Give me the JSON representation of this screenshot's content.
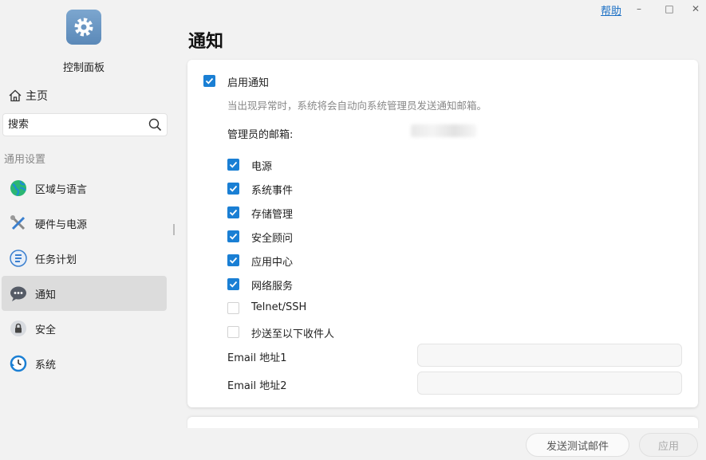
{
  "app": {
    "title": "控制面板",
    "help_label": "帮助",
    "window_controls": {
      "minimize": "–",
      "maximize": "□",
      "close": "✕"
    }
  },
  "sidebar": {
    "home_label": "主页",
    "search_placeholder": "搜索",
    "section_label": "通用设置",
    "items": [
      {
        "label": "区域与语言",
        "icon": "globe-icon"
      },
      {
        "label": "硬件与电源",
        "icon": "tools-icon"
      },
      {
        "label": "任务计划",
        "icon": "task-list-icon"
      },
      {
        "label": "通知",
        "icon": "chat-bubble-icon",
        "active": true
      },
      {
        "label": "安全",
        "icon": "lock-icon"
      },
      {
        "label": "系统",
        "icon": "clock-refresh-icon"
      }
    ]
  },
  "main": {
    "title": "通知",
    "enable": {
      "label": "启用通知",
      "checked": true
    },
    "description": "当出现异常时，系统将会自动向系统管理员发送通知邮箱。",
    "admin_email_label": "管理员的邮箱:",
    "categories": [
      {
        "label": "电源",
        "checked": true
      },
      {
        "label": "系统事件",
        "checked": true
      },
      {
        "label": "存储管理",
        "checked": true
      },
      {
        "label": "安全顾问",
        "checked": true
      },
      {
        "label": "应用中心",
        "checked": true
      },
      {
        "label": "网络服务",
        "checked": true
      },
      {
        "label": "Telnet/SSH",
        "checked": false
      },
      {
        "label": "抄送至以下收件人",
        "checked": false
      }
    ],
    "email1_label": "Email 地址1",
    "email1_value": "",
    "email2_label": "Email 地址2",
    "email2_value": ""
  },
  "footer": {
    "test_button": "发送测试邮件",
    "apply_button": "应用"
  },
  "colors": {
    "accent": "#1a7fd4",
    "link": "#1a6fc4",
    "active_nav": "#dcdcdc"
  }
}
